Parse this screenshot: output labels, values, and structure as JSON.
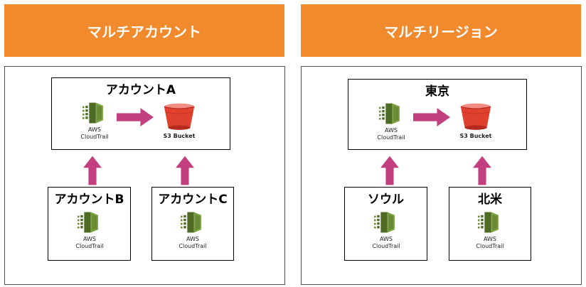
{
  "colors": {
    "header": "#f08a2c",
    "arrow": "#c2407f",
    "cloudtrail": "#6a8a35",
    "s3": "#e0412f"
  },
  "left": {
    "header": "マルチアカウント",
    "top_box": "アカウントA",
    "bottom_left_box": "アカウントB",
    "bottom_right_box": "アカウントC"
  },
  "right": {
    "header": "マルチリージョン",
    "top_box": "東京",
    "bottom_left_box": "ソウル",
    "bottom_right_box": "北米"
  },
  "cloudtrail": {
    "line1": "AWS",
    "line2": "CloudTrail",
    "icon": "cloudtrail-icon"
  },
  "s3": {
    "label": "S3 Bucket",
    "icon": "s3-bucket-icon"
  }
}
